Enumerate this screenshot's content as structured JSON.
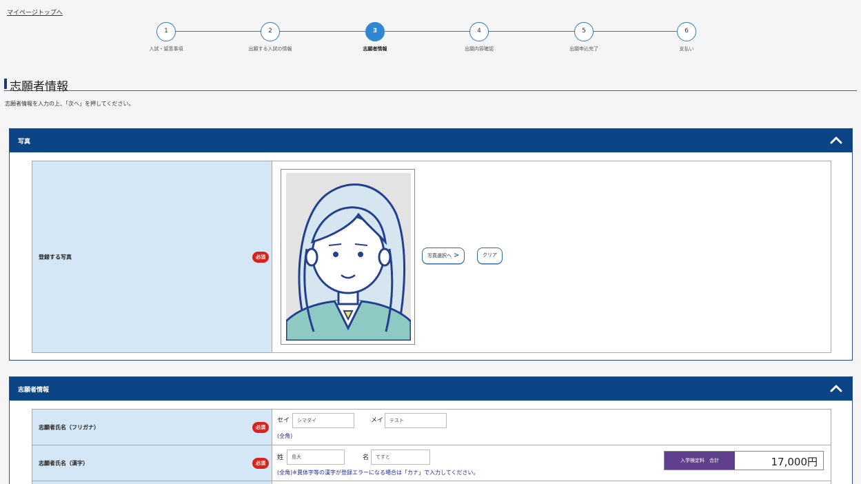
{
  "top_link": "マイページトップへ",
  "steps": [
    {
      "num": "1",
      "label": "入試・留意事項"
    },
    {
      "num": "2",
      "label": "出願する入試の情報"
    },
    {
      "num": "3",
      "label": "志願者情報"
    },
    {
      "num": "4",
      "label": "出願内容確認"
    },
    {
      "num": "5",
      "label": "出願申込完了"
    },
    {
      "num": "6",
      "label": "支払い"
    }
  ],
  "active_step": "3",
  "page_title": "志願者情報",
  "intro_text": "志願者情報を入力の上、「次へ」を押してください。",
  "photo_panel": {
    "title": "写真",
    "label": "登録する写真",
    "required": "必須",
    "select_button": "写真選択へ",
    "clear_button": "クリア"
  },
  "applicant_panel": {
    "title": "志願者情報",
    "kana": {
      "label": "志願者氏名（フリガナ）",
      "required": "必須",
      "sei_prefix": "セイ",
      "sei_value": "シマダイ",
      "mei_prefix": "メイ",
      "mei_value": "テスト",
      "note": "(全角)"
    },
    "kanji": {
      "label": "志願者氏名（漢字）",
      "required": "必須",
      "sei_prefix": "姓",
      "sei_value": "島大",
      "mei_prefix": "名",
      "mei_value": "てすと",
      "note": "(全角)※異体字等の漢字が登録エラーになる場合は「カナ」で入力してください。"
    }
  },
  "fee": {
    "label": "入学検定料　合計",
    "value": "17,000円"
  },
  "colors": {
    "header_bg": "#0b4485",
    "label_bg": "#d3e7f6",
    "required_bg": "#d9231d",
    "step_active": "#2e87d0",
    "fee_label_bg": "#5f3f8e"
  }
}
